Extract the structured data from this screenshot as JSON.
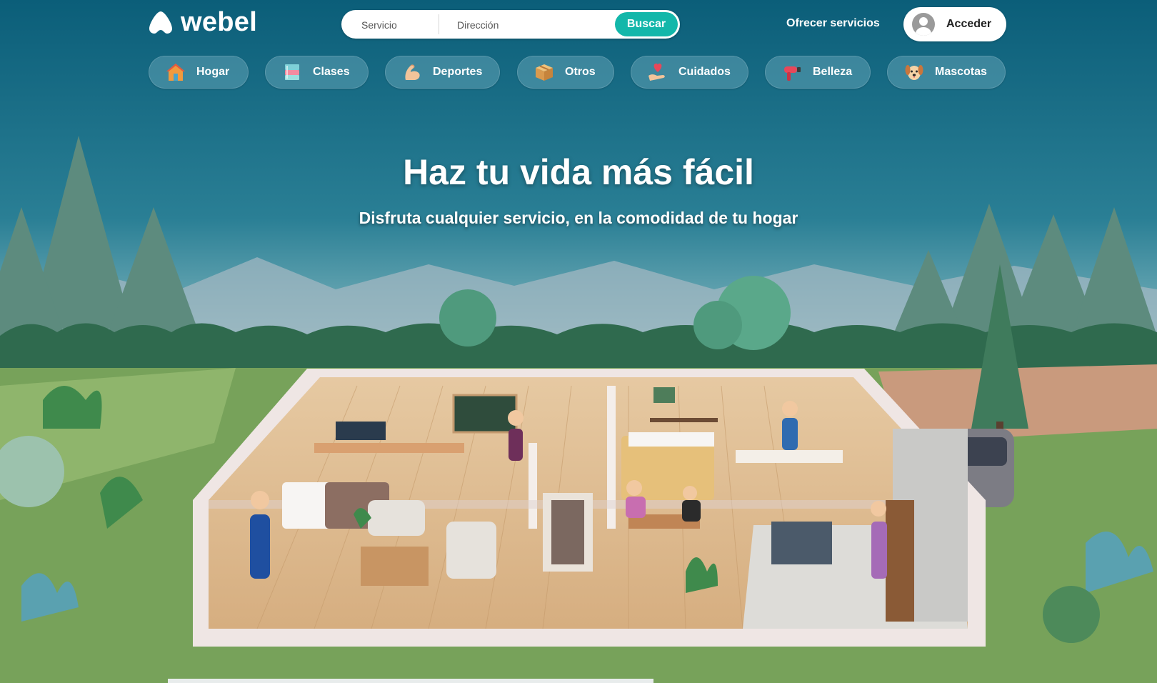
{
  "brand": {
    "name": "webel"
  },
  "search": {
    "service_placeholder": "Servicio",
    "address_placeholder": "Dirección",
    "button_label": "Buscar"
  },
  "nav": {
    "offer_label": "Ofrecer servicios",
    "login_label": "Acceder"
  },
  "categories": [
    {
      "label": "Hogar",
      "icon": "house-icon"
    },
    {
      "label": "Clases",
      "icon": "books-icon"
    },
    {
      "label": "Deportes",
      "icon": "flexed-arm-icon"
    },
    {
      "label": "Otros",
      "icon": "box-icon"
    },
    {
      "label": "Cuidados",
      "icon": "heart-hand-icon"
    },
    {
      "label": "Belleza",
      "icon": "hair-dryer-icon"
    },
    {
      "label": "Mascotas",
      "icon": "dog-icon"
    }
  ],
  "hero": {
    "title": "Haz tu vida más fácil",
    "subtitle": "Disfruta cualquier servicio, en la comodidad de tu hogar"
  },
  "colors": {
    "accent": "#13b7aa",
    "sky_top": "#0b5f79",
    "sky_bottom": "#6aaebc",
    "category_pill": "#5fa0b4"
  }
}
